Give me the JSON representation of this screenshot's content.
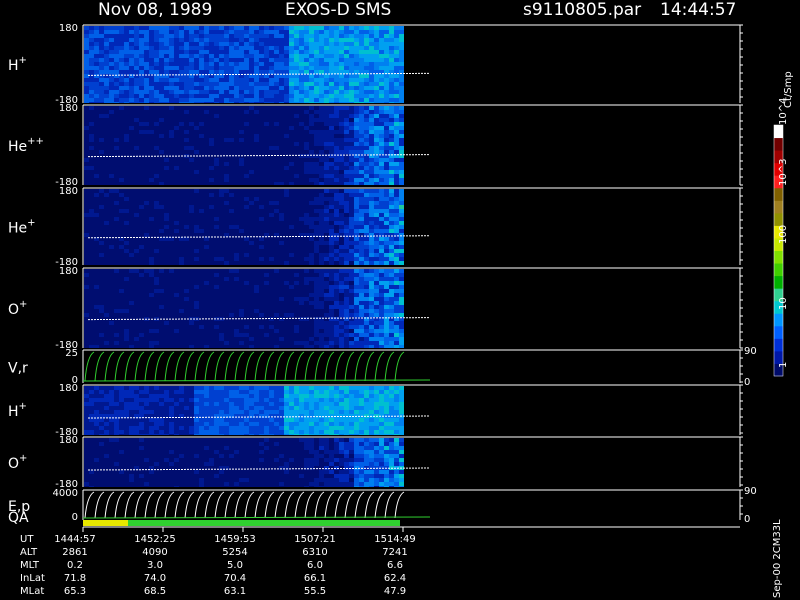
{
  "header": {
    "date": "Nov 08, 1989",
    "instrument": "EXOS-D SMS",
    "file": "s9110805.par",
    "time": "14:44:57"
  },
  "colorbar": {
    "unit": "Ct/Smp",
    "ticks": [
      "1",
      "10",
      "100",
      "10^3",
      "10^4"
    ],
    "colors": [
      "#000b6a",
      "#0018a8",
      "#0030d8",
      "#0060ff",
      "#0096ff",
      "#00c8d0",
      "#30d090",
      "#00b000",
      "#40d000",
      "#80e000",
      "#c8e800",
      "#e8e800",
      "#909000",
      "#a08020",
      "#806000",
      "#ff2020",
      "#e00000",
      "#a00000",
      "#700000",
      "#ffffff"
    ]
  },
  "panels": [
    {
      "id": "h-plus",
      "label": "H",
      "sup": "+",
      "ymax": "180",
      "ymin": "-180"
    },
    {
      "id": "he-plus-plus",
      "label": "He",
      "sup": "++",
      "ymax": "180",
      "ymin": "-180"
    },
    {
      "id": "he-plus",
      "label": "He",
      "sup": "+",
      "ymax": "180",
      "ymin": "-180"
    },
    {
      "id": "o-plus",
      "label": "O",
      "sup": "+",
      "ymax": "180",
      "ymin": "-180"
    },
    {
      "id": "v-r",
      "label": "V,r",
      "sup": "",
      "ymax": "25",
      "ymin": "0",
      "right_top": "90",
      "right_bottom": "0"
    },
    {
      "id": "h-plus-2",
      "label": "H",
      "sup": "+",
      "ymax": "180",
      "ymin": "-180"
    },
    {
      "id": "o-plus-2",
      "label": "O",
      "sup": "+",
      "ymax": "180",
      "ymin": "-180"
    },
    {
      "id": "e-p",
      "label": "E,p",
      "sup": "",
      "ymax": "4000",
      "ymin": "0",
      "right_top": "90",
      "right_bottom": "0"
    }
  ],
  "qa_label": "QA",
  "ephemeris": {
    "rows": [
      {
        "name": "UT",
        "values": [
          "1444:57",
          "1452:25",
          "1459:53",
          "1507:21",
          "1514:49"
        ]
      },
      {
        "name": "ALT",
        "values": [
          "2861",
          "4090",
          "5254",
          "6310",
          "7241"
        ]
      },
      {
        "name": "MLT",
        "values": [
          "0.2",
          "3.0",
          "5.0",
          "6.0",
          "6.6"
        ]
      },
      {
        "name": "InLat",
        "values": [
          "71.8",
          "74.0",
          "70.4",
          "66.1",
          "62.4"
        ]
      },
      {
        "name": "MLat",
        "values": [
          "65.3",
          "68.5",
          "63.1",
          "55.5",
          "47.9"
        ]
      }
    ]
  },
  "side_note": "Sep-00 2CM33L",
  "chart_data": [
    {
      "type": "heatmap",
      "title": "H+",
      "ylim": [
        -180,
        180
      ],
      "data_extent_ut": [
        "1444:57",
        "1514:49"
      ]
    },
    {
      "type": "heatmap",
      "title": "He++",
      "ylim": [
        -180,
        180
      ],
      "data_extent_ut": [
        "1444:57",
        "1514:49"
      ]
    },
    {
      "type": "heatmap",
      "title": "He+",
      "ylim": [
        -180,
        180
      ],
      "data_extent_ut": [
        "1444:57",
        "1514:49"
      ]
    },
    {
      "type": "heatmap",
      "title": "O+",
      "ylim": [
        -180,
        180
      ],
      "data_extent_ut": [
        "1444:57",
        "1514:49"
      ]
    },
    {
      "type": "line",
      "title": "V,r",
      "ylim": [
        0,
        25
      ],
      "y2lim": [
        0,
        90
      ]
    },
    {
      "type": "heatmap",
      "title": "H+",
      "ylim": [
        -180,
        180
      ]
    },
    {
      "type": "heatmap",
      "title": "O+",
      "ylim": [
        -180,
        180
      ]
    },
    {
      "type": "line",
      "title": "E,p",
      "ylim": [
        0,
        4000
      ],
      "y2lim": [
        0,
        90
      ]
    }
  ]
}
